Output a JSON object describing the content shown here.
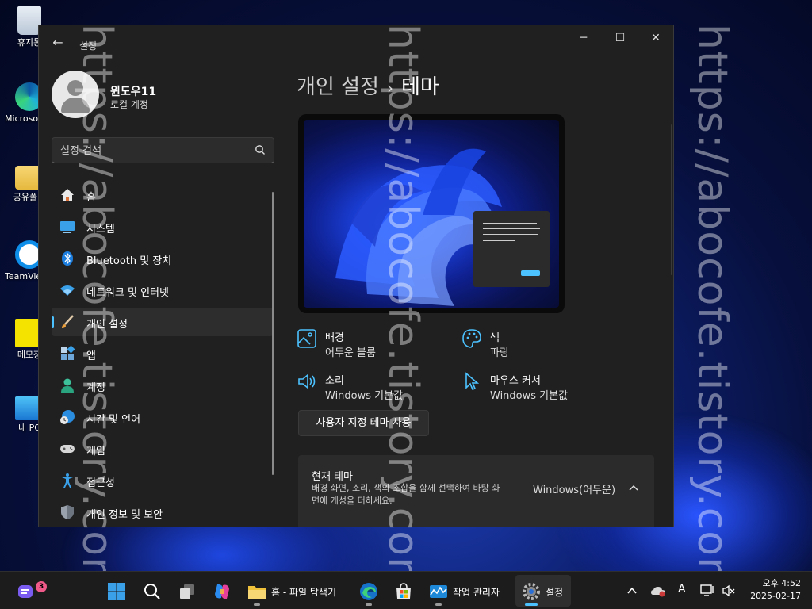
{
  "desktop": {
    "icons": [
      {
        "label": "휴지통"
      },
      {
        "label": "Microsoft Edge"
      },
      {
        "label": "공유폴더"
      },
      {
        "label": "TeamViewer"
      },
      {
        "label": "메모장"
      },
      {
        "label": "내 PC"
      }
    ]
  },
  "window": {
    "title": "설정",
    "controls": {
      "minimize": "─",
      "maximize": "☐",
      "close": "✕"
    },
    "back": "←"
  },
  "profile": {
    "name": "윈도우11",
    "account_type": "로컬 계정"
  },
  "search": {
    "placeholder": "설정 검색"
  },
  "nav": {
    "items": [
      {
        "label": "홈",
        "icon": "home-icon"
      },
      {
        "label": "시스템",
        "icon": "system-icon"
      },
      {
        "label": "Bluetooth 및 장치",
        "icon": "bluetooth-icon"
      },
      {
        "label": "네트워크 및 인터넷",
        "icon": "wifi-icon"
      },
      {
        "label": "개인 설정",
        "icon": "brush-icon",
        "active": true
      },
      {
        "label": "앱",
        "icon": "apps-icon"
      },
      {
        "label": "계정",
        "icon": "account-icon"
      },
      {
        "label": "시간 및 언어",
        "icon": "time-language-icon"
      },
      {
        "label": "게임",
        "icon": "gamepad-icon"
      },
      {
        "label": "접근성",
        "icon": "accessibility-icon"
      },
      {
        "label": "개인 정보 및 보안",
        "icon": "shield-icon"
      }
    ]
  },
  "breadcrumb": {
    "parent": "개인 설정",
    "separator": "›",
    "current": "테마"
  },
  "theme_attributes": {
    "background": {
      "name": "배경",
      "value": "어두운 블룸"
    },
    "color": {
      "name": "색",
      "value": "파랑"
    },
    "sound": {
      "name": "소리",
      "value": "Windows 기본값"
    },
    "cursor": {
      "name": "마우스 커서",
      "value": "Windows 기본값"
    }
  },
  "custom_theme_button": "사용자 지정 테마 사용",
  "current_theme": {
    "title": "현재 테마",
    "description": "배경 화면, 소리, 색의 조합을 함께 선택하여 바탕 화면에 개성을 더하세요.",
    "value": "Windows(어두운)"
  },
  "watermark": {
    "text": "https://abocofe.tistory.com/"
  },
  "taskbar": {
    "widgets_badge": "3",
    "apps": [
      {
        "label": "",
        "icon": "start-icon"
      },
      {
        "label": "",
        "icon": "search-icon"
      },
      {
        "label": "",
        "icon": "task-view-icon"
      },
      {
        "label": "",
        "icon": "copilot-icon"
      },
      {
        "label": "홈 - 파일 탐색기",
        "icon": "folder-icon"
      },
      {
        "label": "",
        "icon": "edge-icon"
      },
      {
        "label": "",
        "icon": "store-icon"
      },
      {
        "label": "작업 관리자",
        "icon": "task-manager-icon"
      },
      {
        "label": "설정",
        "icon": "settings-gear-icon"
      }
    ],
    "tray": {
      "chevron": "^",
      "ime": "A"
    },
    "clock": {
      "time": "오후 4:52",
      "date": "2025-02-17"
    }
  },
  "colors": {
    "accent": "#4cc2ff",
    "window_bg": "#202020",
    "card_bg": "#2b2b2b"
  }
}
